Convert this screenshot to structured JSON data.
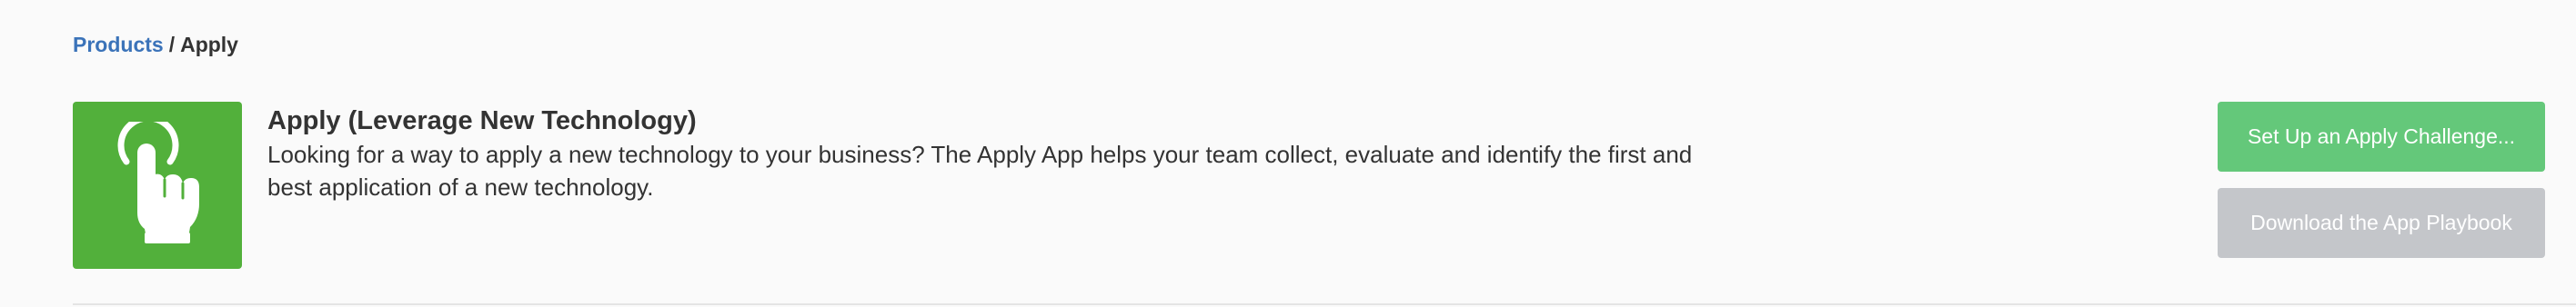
{
  "breadcrumb": {
    "parent": "Products",
    "separator": "/",
    "current": "Apply"
  },
  "app": {
    "title": "Apply (Leverage New Technology)",
    "description": "Looking for a way to apply a new technology to your business? The Apply App helps your team collect, evaluate and identify the first and best application of a new technology.",
    "icon": "tap-hand-icon",
    "tile_color": "#52b03b"
  },
  "actions": {
    "setup_label": "Set Up an Apply Challenge...",
    "playbook_label": "Download the App Playbook"
  },
  "colors": {
    "link": "#3b73b9",
    "primary_button": "#64c87a",
    "disabled_button": "#c4c6ca"
  }
}
